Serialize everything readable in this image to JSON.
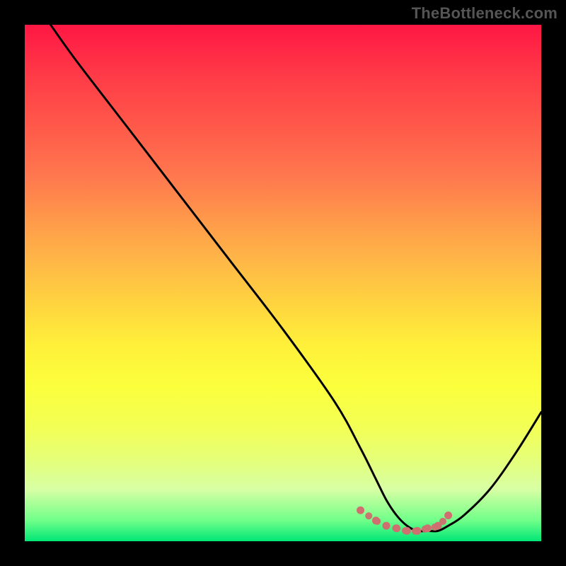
{
  "attribution": "TheBottleneck.com",
  "chart_data": {
    "type": "line",
    "title": "",
    "xlabel": "",
    "ylabel": "",
    "xlim": [
      0,
      100
    ],
    "ylim": [
      0,
      100
    ],
    "series": [
      {
        "name": "curve",
        "x": [
          5,
          10,
          20,
          30,
          40,
          50,
          60,
          65,
          68,
          70,
          72,
          74,
          76,
          78,
          80,
          82,
          85,
          90,
          95,
          100
        ],
        "values": [
          100,
          93,
          80,
          67,
          54,
          41,
          27,
          18,
          12,
          8,
          5,
          3,
          2,
          2,
          2,
          3,
          5,
          10,
          17,
          25
        ]
      },
      {
        "name": "dots",
        "x": [
          65,
          68,
          70,
          72,
          74,
          76,
          78,
          80,
          82
        ],
        "values": [
          6,
          4,
          3,
          2.5,
          2,
          2,
          2.5,
          3,
          5
        ]
      }
    ],
    "colors": {
      "curve": "#000000",
      "dots": "#cf6f6f"
    }
  }
}
